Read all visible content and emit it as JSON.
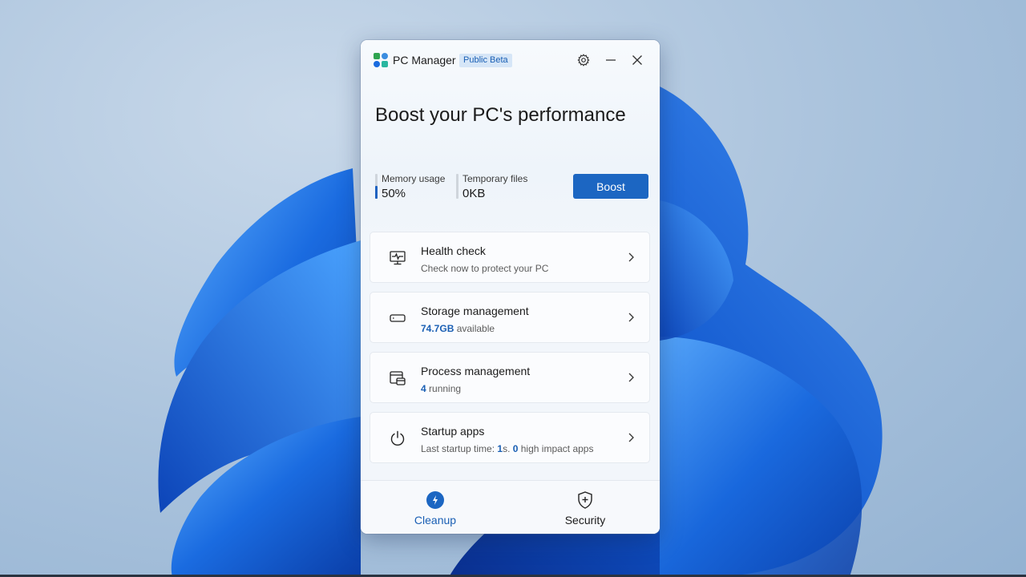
{
  "desktop": {
    "accent": "#1a6be0"
  },
  "app": {
    "name": "PC Manager",
    "badge": "Public Beta",
    "accent": "#1c66c2"
  },
  "titlebar_icons": [
    "settings-icon",
    "minimize-icon",
    "close-icon"
  ],
  "hero": {
    "headline": "Boost your PC's performance",
    "memory": {
      "label": "Memory usage",
      "value": "50%",
      "fill_fraction": 0.5
    },
    "temp_files": {
      "label": "Temporary files",
      "value": "0KB",
      "fill_fraction": 0
    },
    "boost_label": "Boost"
  },
  "cards": {
    "health": {
      "title": "Health check",
      "subtitle": "Check now to protect your PC",
      "icon": "monitor-pulse-icon"
    },
    "storage": {
      "title": "Storage management",
      "amount": "74.7GB",
      "suffix": " available",
      "icon": "drive-icon"
    },
    "process": {
      "title": "Process management",
      "count": "4",
      "suffix": " running",
      "icon": "process-windows-icon"
    },
    "startup": {
      "title": "Startup apps",
      "prefix": "Last startup time: ",
      "time": "1",
      "mid": "s. ",
      "impact": "0",
      "suffix": " high impact apps",
      "icon": "power-icon"
    }
  },
  "nav": {
    "cleanup": {
      "label": "Cleanup",
      "icon": "lightning-icon",
      "selected": true
    },
    "security": {
      "label": "Security",
      "icon": "shield-plus-icon",
      "selected": false
    }
  }
}
